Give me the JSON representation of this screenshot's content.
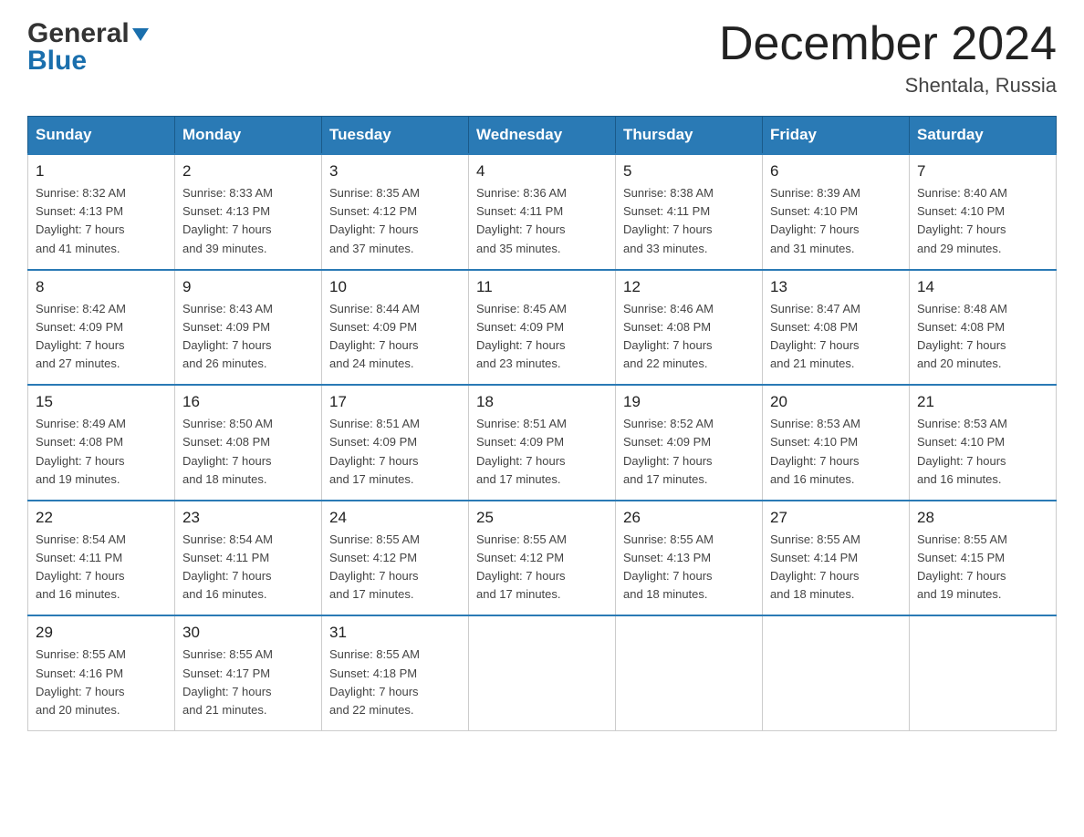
{
  "header": {
    "logo_line1": "General",
    "logo_triangle": "▶",
    "logo_line2": "Blue",
    "month_title": "December 2024",
    "location": "Shentala, Russia"
  },
  "weekdays": [
    "Sunday",
    "Monday",
    "Tuesday",
    "Wednesday",
    "Thursday",
    "Friday",
    "Saturday"
  ],
  "weeks": [
    [
      {
        "day": "1",
        "sunrise": "Sunrise: 8:32 AM",
        "sunset": "Sunset: 4:13 PM",
        "daylight": "Daylight: 7 hours",
        "minutes": "and 41 minutes."
      },
      {
        "day": "2",
        "sunrise": "Sunrise: 8:33 AM",
        "sunset": "Sunset: 4:13 PM",
        "daylight": "Daylight: 7 hours",
        "minutes": "and 39 minutes."
      },
      {
        "day": "3",
        "sunrise": "Sunrise: 8:35 AM",
        "sunset": "Sunset: 4:12 PM",
        "daylight": "Daylight: 7 hours",
        "minutes": "and 37 minutes."
      },
      {
        "day": "4",
        "sunrise": "Sunrise: 8:36 AM",
        "sunset": "Sunset: 4:11 PM",
        "daylight": "Daylight: 7 hours",
        "minutes": "and 35 minutes."
      },
      {
        "day": "5",
        "sunrise": "Sunrise: 8:38 AM",
        "sunset": "Sunset: 4:11 PM",
        "daylight": "Daylight: 7 hours",
        "minutes": "and 33 minutes."
      },
      {
        "day": "6",
        "sunrise": "Sunrise: 8:39 AM",
        "sunset": "Sunset: 4:10 PM",
        "daylight": "Daylight: 7 hours",
        "minutes": "and 31 minutes."
      },
      {
        "day": "7",
        "sunrise": "Sunrise: 8:40 AM",
        "sunset": "Sunset: 4:10 PM",
        "daylight": "Daylight: 7 hours",
        "minutes": "and 29 minutes."
      }
    ],
    [
      {
        "day": "8",
        "sunrise": "Sunrise: 8:42 AM",
        "sunset": "Sunset: 4:09 PM",
        "daylight": "Daylight: 7 hours",
        "minutes": "and 27 minutes."
      },
      {
        "day": "9",
        "sunrise": "Sunrise: 8:43 AM",
        "sunset": "Sunset: 4:09 PM",
        "daylight": "Daylight: 7 hours",
        "minutes": "and 26 minutes."
      },
      {
        "day": "10",
        "sunrise": "Sunrise: 8:44 AM",
        "sunset": "Sunset: 4:09 PM",
        "daylight": "Daylight: 7 hours",
        "minutes": "and 24 minutes."
      },
      {
        "day": "11",
        "sunrise": "Sunrise: 8:45 AM",
        "sunset": "Sunset: 4:09 PM",
        "daylight": "Daylight: 7 hours",
        "minutes": "and 23 minutes."
      },
      {
        "day": "12",
        "sunrise": "Sunrise: 8:46 AM",
        "sunset": "Sunset: 4:08 PM",
        "daylight": "Daylight: 7 hours",
        "minutes": "and 22 minutes."
      },
      {
        "day": "13",
        "sunrise": "Sunrise: 8:47 AM",
        "sunset": "Sunset: 4:08 PM",
        "daylight": "Daylight: 7 hours",
        "minutes": "and 21 minutes."
      },
      {
        "day": "14",
        "sunrise": "Sunrise: 8:48 AM",
        "sunset": "Sunset: 4:08 PM",
        "daylight": "Daylight: 7 hours",
        "minutes": "and 20 minutes."
      }
    ],
    [
      {
        "day": "15",
        "sunrise": "Sunrise: 8:49 AM",
        "sunset": "Sunset: 4:08 PM",
        "daylight": "Daylight: 7 hours",
        "minutes": "and 19 minutes."
      },
      {
        "day": "16",
        "sunrise": "Sunrise: 8:50 AM",
        "sunset": "Sunset: 4:08 PM",
        "daylight": "Daylight: 7 hours",
        "minutes": "and 18 minutes."
      },
      {
        "day": "17",
        "sunrise": "Sunrise: 8:51 AM",
        "sunset": "Sunset: 4:09 PM",
        "daylight": "Daylight: 7 hours",
        "minutes": "and 17 minutes."
      },
      {
        "day": "18",
        "sunrise": "Sunrise: 8:51 AM",
        "sunset": "Sunset: 4:09 PM",
        "daylight": "Daylight: 7 hours",
        "minutes": "and 17 minutes."
      },
      {
        "day": "19",
        "sunrise": "Sunrise: 8:52 AM",
        "sunset": "Sunset: 4:09 PM",
        "daylight": "Daylight: 7 hours",
        "minutes": "and 17 minutes."
      },
      {
        "day": "20",
        "sunrise": "Sunrise: 8:53 AM",
        "sunset": "Sunset: 4:10 PM",
        "daylight": "Daylight: 7 hours",
        "minutes": "and 16 minutes."
      },
      {
        "day": "21",
        "sunrise": "Sunrise: 8:53 AM",
        "sunset": "Sunset: 4:10 PM",
        "daylight": "Daylight: 7 hours",
        "minutes": "and 16 minutes."
      }
    ],
    [
      {
        "day": "22",
        "sunrise": "Sunrise: 8:54 AM",
        "sunset": "Sunset: 4:11 PM",
        "daylight": "Daylight: 7 hours",
        "minutes": "and 16 minutes."
      },
      {
        "day": "23",
        "sunrise": "Sunrise: 8:54 AM",
        "sunset": "Sunset: 4:11 PM",
        "daylight": "Daylight: 7 hours",
        "minutes": "and 16 minutes."
      },
      {
        "day": "24",
        "sunrise": "Sunrise: 8:55 AM",
        "sunset": "Sunset: 4:12 PM",
        "daylight": "Daylight: 7 hours",
        "minutes": "and 17 minutes."
      },
      {
        "day": "25",
        "sunrise": "Sunrise: 8:55 AM",
        "sunset": "Sunset: 4:12 PM",
        "daylight": "Daylight: 7 hours",
        "minutes": "and 17 minutes."
      },
      {
        "day": "26",
        "sunrise": "Sunrise: 8:55 AM",
        "sunset": "Sunset: 4:13 PM",
        "daylight": "Daylight: 7 hours",
        "minutes": "and 18 minutes."
      },
      {
        "day": "27",
        "sunrise": "Sunrise: 8:55 AM",
        "sunset": "Sunset: 4:14 PM",
        "daylight": "Daylight: 7 hours",
        "minutes": "and 18 minutes."
      },
      {
        "day": "28",
        "sunrise": "Sunrise: 8:55 AM",
        "sunset": "Sunset: 4:15 PM",
        "daylight": "Daylight: 7 hours",
        "minutes": "and 19 minutes."
      }
    ],
    [
      {
        "day": "29",
        "sunrise": "Sunrise: 8:55 AM",
        "sunset": "Sunset: 4:16 PM",
        "daylight": "Daylight: 7 hours",
        "minutes": "and 20 minutes."
      },
      {
        "day": "30",
        "sunrise": "Sunrise: 8:55 AM",
        "sunset": "Sunset: 4:17 PM",
        "daylight": "Daylight: 7 hours",
        "minutes": "and 21 minutes."
      },
      {
        "day": "31",
        "sunrise": "Sunrise: 8:55 AM",
        "sunset": "Sunset: 4:18 PM",
        "daylight": "Daylight: 7 hours",
        "minutes": "and 22 minutes."
      },
      null,
      null,
      null,
      null
    ]
  ]
}
